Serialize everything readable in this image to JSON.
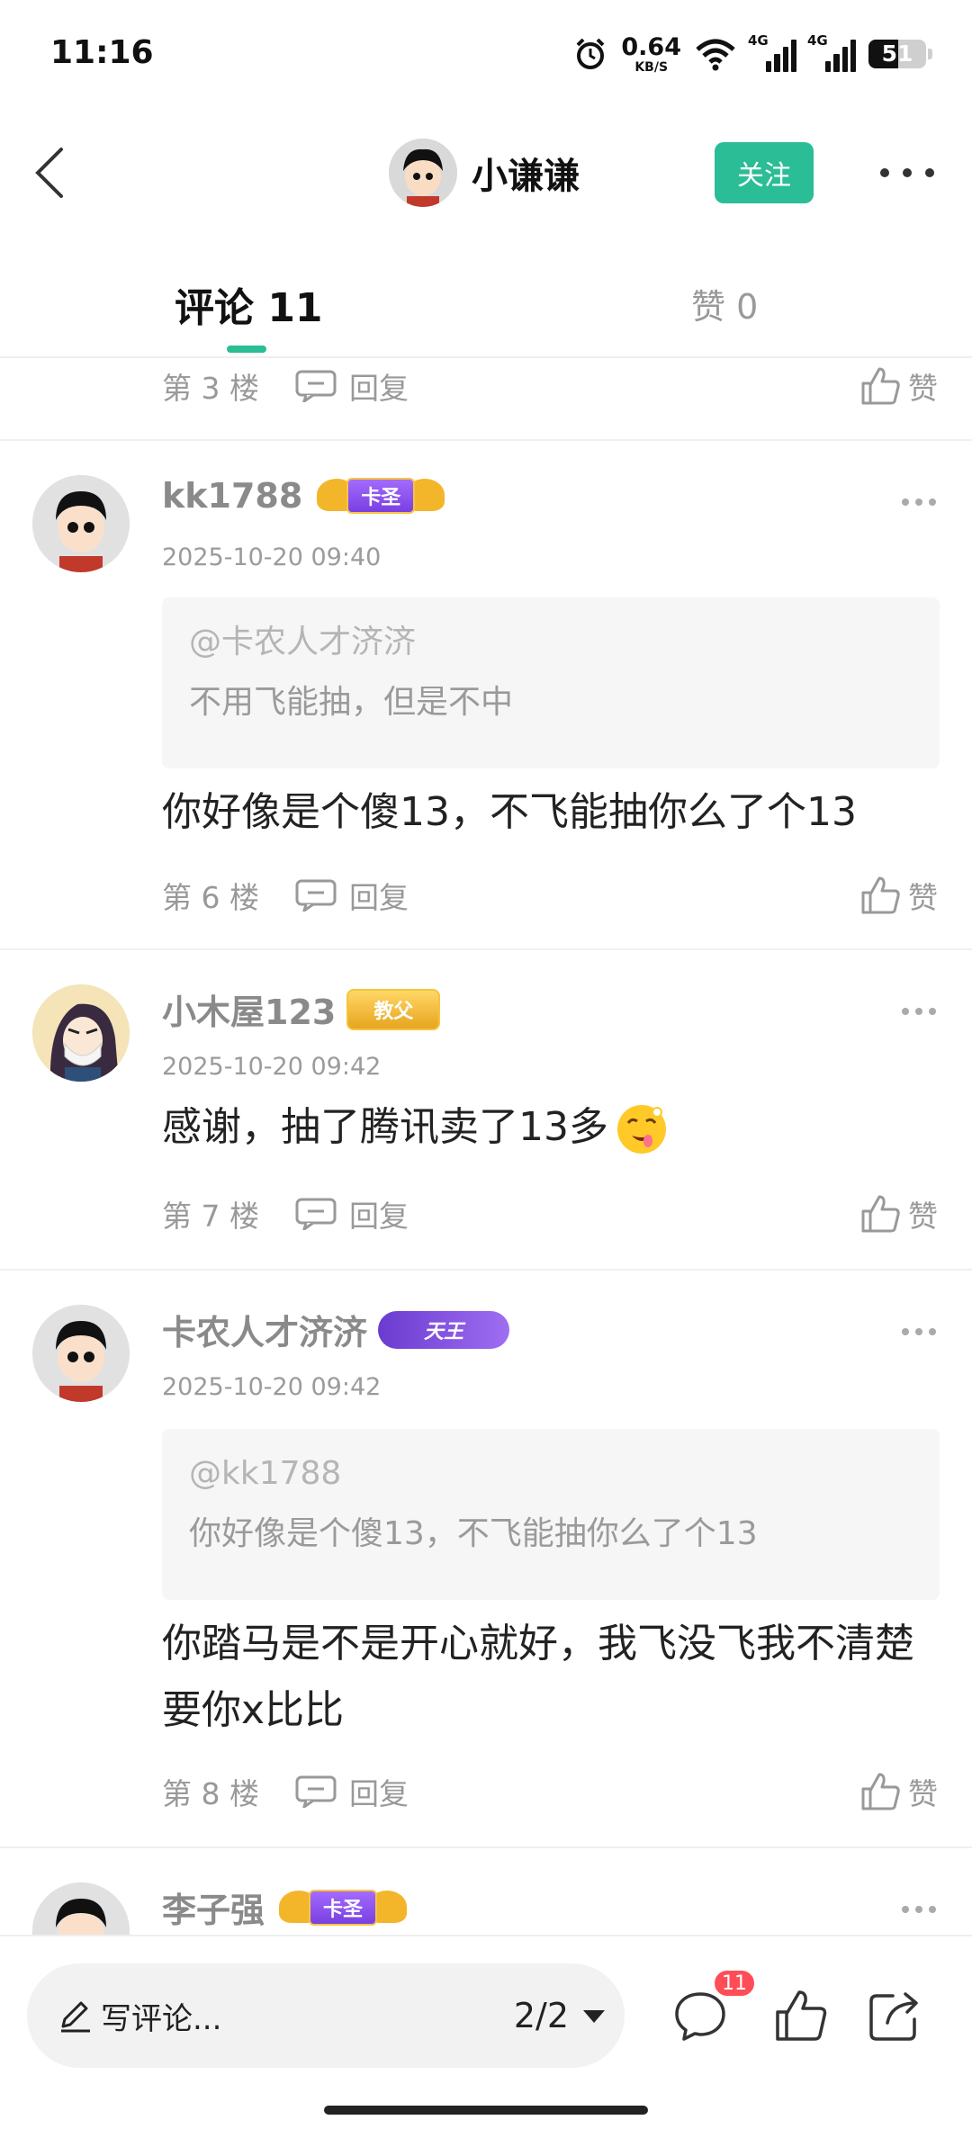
{
  "status_bar": {
    "time": "11:16",
    "net_speed_value": "0.64",
    "net_speed_unit": "KB/S",
    "network_1": "4G",
    "network_2": "4G",
    "battery": "51",
    "battery_level": 0.51
  },
  "header": {
    "username": "小谦谦",
    "follow_label": "关注"
  },
  "tabs": {
    "comments_label": "评论 11",
    "likes_label": "赞 0"
  },
  "labels": {
    "reply": "回复",
    "like": "赞"
  },
  "first_partial": {
    "floor": "第 3 楼"
  },
  "comments": [
    {
      "username": "kk1788",
      "badge": "卡圣",
      "time": "2025-10-20 09:40",
      "quote_at": "@卡农人才济济",
      "quote_text": "不用飞能抽，但是不中",
      "text": "你好像是个傻13，不飞能抽你么了个13",
      "floor": "第 6 楼"
    },
    {
      "username": "小木屋123",
      "badge": "教父",
      "time": "2025-10-20 09:42",
      "text": "感谢，抽了腾讯卖了13多",
      "floor": "第 7 楼"
    },
    {
      "username": "卡农人才济济",
      "badge": "天王",
      "time": "2025-10-20 09:42",
      "quote_at": "@kk1788",
      "quote_text": "你好像是个傻13，不飞能抽你么了个13",
      "text": "你踏马是不是开心就好，我飞没飞我不清楚要你x比比",
      "floor": "第 8 楼"
    },
    {
      "username": "李子强",
      "badge": "卡圣"
    }
  ],
  "bottom_bar": {
    "placeholder": "写评论...",
    "page": "2/2",
    "comment_count": "11"
  },
  "colors": {
    "accent": "#2bbd95",
    "badge_red": "#ff4d57"
  }
}
